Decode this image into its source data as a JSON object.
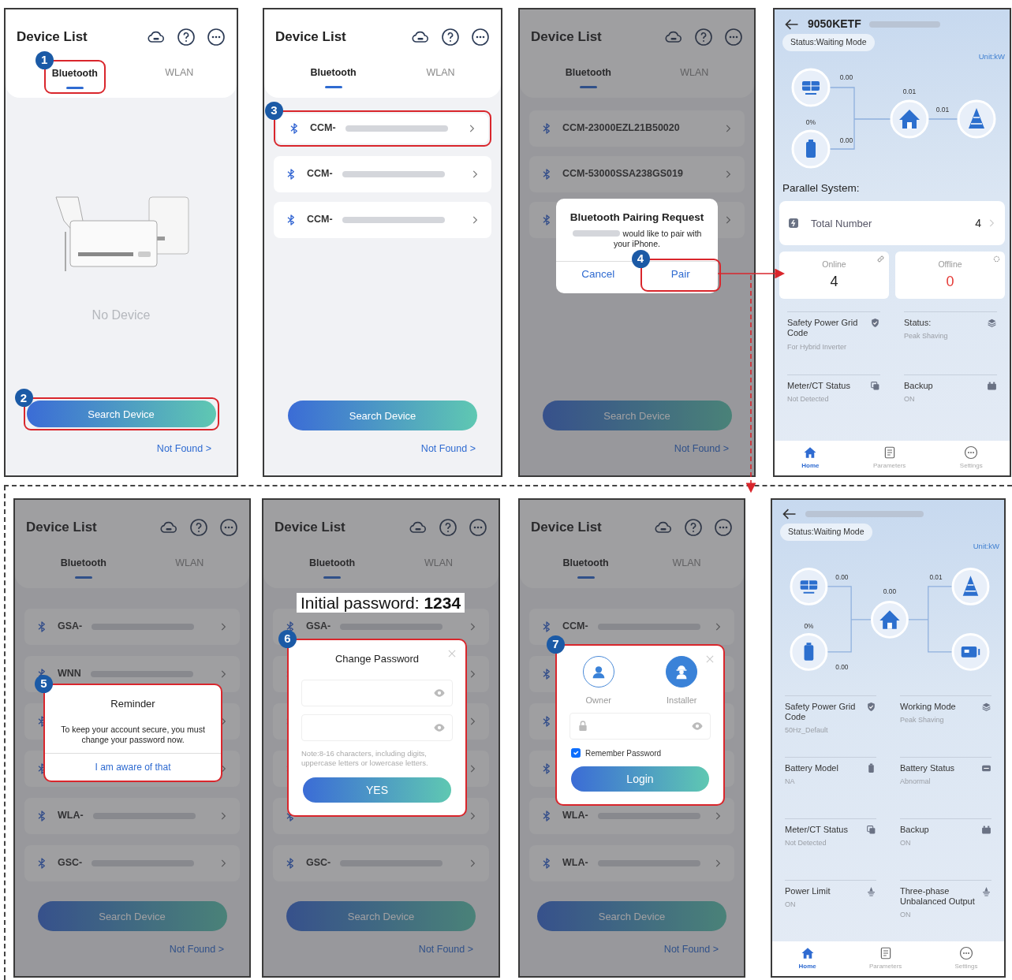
{
  "panels": [
    {
      "kind": "device_list",
      "title": "Device List",
      "dimmed": false,
      "tabs": [
        {
          "label": "Bluetooth",
          "selected": true,
          "step": "1"
        },
        {
          "label": "WLAN",
          "selected": false
        }
      ],
      "empty_text": "No Device",
      "search_button": {
        "label": "Search Device",
        "step": "2"
      },
      "not_found": "Not Found >"
    },
    {
      "kind": "device_list",
      "title": "Device List",
      "dimmed": false,
      "tabs": [
        {
          "label": "Bluetooth",
          "selected": true
        },
        {
          "label": "WLAN",
          "selected": false
        }
      ],
      "devices": [
        {
          "kind": "device",
          "name": "CCM-",
          "redacted": true,
          "step": "3"
        },
        {
          "kind": "device",
          "name": "CCM-",
          "redacted": true
        },
        {
          "kind": "device",
          "name": "CCM-",
          "redacted": true
        }
      ],
      "search_button": {
        "label": "Search Device"
      },
      "not_found": "Not Found >"
    },
    {
      "kind": "device_list",
      "title": "Device List",
      "dimmed": true,
      "tabs": [
        {
          "label": "Bluetooth",
          "selected": true
        },
        {
          "label": "WLAN",
          "selected": false
        }
      ],
      "devices": [
        {
          "kind": "device",
          "name": "CCM-23000EZL21B50020",
          "redacted": false
        },
        {
          "kind": "device",
          "name": "CCM-53000SSA238GS019",
          "redacted": false
        },
        {
          "kind": "covered"
        }
      ],
      "search_button": {
        "label": "Search Device"
      },
      "not_found": "Not Found >",
      "dialog": {
        "kind": "pairing",
        "title": "Bluetooth Pairing Request",
        "redacted": true,
        "message": "would like to pair with your iPhone.",
        "buttons": [
          {
            "label": "Cancel"
          },
          {
            "label": "Pair",
            "step": "4"
          }
        ]
      }
    },
    {
      "kind": "dashboard",
      "device_name": "9050KETF",
      "redacted": true,
      "status": "Status:Waiting Mode",
      "unit": "Unit:kW",
      "flow": [
        {
          "kind": "solar",
          "value": "0.00"
        },
        {
          "kind": "battery",
          "value": "0.00",
          "soc": "0%"
        },
        {
          "kind": "home",
          "value": "0.01"
        },
        {
          "kind": "grid",
          "value": "0.01"
        }
      ],
      "parallel": {
        "title": "Parallel System:",
        "total": {
          "label": "Total Number",
          "value": "4"
        },
        "online": {
          "label": "Online",
          "value": "4"
        },
        "offline": {
          "label": "Offline",
          "value": "0"
        }
      },
      "items": [
        {
          "label": "Safety Power Grid Code",
          "value": "For Hybrid Inverter",
          "kind": "grid_code"
        },
        {
          "label": "Status:",
          "value": "Peak Shaving",
          "kind": "mode"
        },
        {
          "label": "Meter/CT Status",
          "value": "Not Detected",
          "kind": "meter"
        },
        {
          "label": "Backup",
          "value": "ON",
          "kind": "backup"
        }
      ],
      "nav": [
        {
          "label": "Home",
          "kind": "home",
          "selected": true
        },
        {
          "label": "Parameters",
          "kind": "parameters",
          "selected": false
        },
        {
          "label": "Settings",
          "kind": "settings",
          "selected": false
        }
      ]
    },
    {
      "kind": "device_list",
      "title": "Device List",
      "dimmed": true,
      "tabs": [
        {
          "label": "Bluetooth",
          "selected": true
        },
        {
          "label": "WLAN",
          "selected": false
        }
      ],
      "devices": [
        {
          "kind": "device",
          "name": "GSA-",
          "redacted": true
        },
        {
          "kind": "device",
          "name": "WNN",
          "redacted": true
        },
        {
          "kind": "covered"
        },
        {
          "kind": "covered"
        },
        {
          "kind": "device",
          "name": "WLA-",
          "redacted": true
        },
        {
          "kind": "device",
          "name": "GSC-",
          "redacted": true
        }
      ],
      "search_button": {
        "label": "Search Device"
      },
      "not_found": "Not Found >",
      "dialog": {
        "kind": "reminder",
        "step": "5",
        "title": "Reminder",
        "message": "To keep your account secure, you must change your password  now.",
        "buttons": [
          {
            "label": "I am aware of that"
          }
        ]
      }
    },
    {
      "kind": "device_list",
      "title": "Device List",
      "dimmed": true,
      "tabs": [
        {
          "label": "Bluetooth",
          "selected": true
        },
        {
          "label": "WLAN",
          "selected": false
        }
      ],
      "caption": "Initial password: **1234**",
      "devices": [
        {
          "kind": "device",
          "name": "GSA-",
          "redacted": true
        },
        {
          "kind": "covered"
        },
        {
          "kind": "covered"
        },
        {
          "kind": "covered"
        },
        {
          "kind": "covered"
        },
        {
          "kind": "device",
          "name": "GSC-",
          "redacted": true
        }
      ],
      "search_button": {
        "label": "Search Device"
      },
      "not_found": "Not Found >",
      "dialog": {
        "kind": "change_password",
        "step": "6",
        "title": "Change Password",
        "closable": true,
        "fields": [
          {
            "kind": "password"
          },
          {
            "kind": "password"
          }
        ],
        "note": "Note:8-16 characters, including digits, uppercase letters or lowercase letters.",
        "buttons": [
          {
            "label": "YES"
          }
        ]
      }
    },
    {
      "kind": "device_list",
      "title": "Device List",
      "dimmed": true,
      "tabs": [
        {
          "label": "Bluetooth",
          "selected": true
        },
        {
          "label": "WLAN",
          "selected": false
        }
      ],
      "devices": [
        {
          "kind": "device",
          "name": "CCM-",
          "redacted": true
        },
        {
          "kind": "covered"
        },
        {
          "kind": "covered"
        },
        {
          "kind": "covered"
        },
        {
          "kind": "device",
          "name": "WLA-",
          "redacted": true
        },
        {
          "kind": "device",
          "name": "WLA-",
          "redacted": true
        }
      ],
      "search_button": {
        "label": "Search Device"
      },
      "not_found": "Not Found >",
      "dialog": {
        "kind": "login",
        "step": "7",
        "closable": true,
        "roles": [
          {
            "label": "Owner",
            "kind": "owner",
            "selected": false
          },
          {
            "label": "Installer",
            "kind": "installer",
            "selected": true
          }
        ],
        "fields": [
          {
            "kind": "locked_password"
          }
        ],
        "remember": {
          "label": "Remember Password",
          "checked": true
        },
        "buttons": [
          {
            "label": "Login"
          }
        ]
      }
    },
    {
      "kind": "dashboard",
      "redacted": true,
      "status": "Status:Waiting Mode",
      "unit": "Unit:kW",
      "flow": [
        {
          "kind": "solar",
          "value": "0.00"
        },
        {
          "kind": "battery",
          "value": "0.00",
          "soc": "0%"
        },
        {
          "kind": "home",
          "value": "0.00"
        },
        {
          "kind": "grid",
          "value": "0.01"
        },
        {
          "kind": "generator"
        }
      ],
      "items": [
        {
          "label": "Safety Power Grid Code",
          "value": "50Hz_Default",
          "kind": "grid_code"
        },
        {
          "label": "Working Mode",
          "value": "Peak Shaving",
          "kind": "mode"
        },
        {
          "label": "Battery Model",
          "value": "NA",
          "kind": "battery_model"
        },
        {
          "label": "Battery Status",
          "value": "Abnormal",
          "kind": "battery_status"
        },
        {
          "label": "Meter/CT Status",
          "value": "Not Detected",
          "kind": "meter"
        },
        {
          "label": "Backup",
          "value": "ON",
          "kind": "backup"
        },
        {
          "label": "Power Limit",
          "value": "ON",
          "kind": "limit"
        },
        {
          "label": "Three-phase Unbalanced Output",
          "value": "ON",
          "kind": "limit"
        }
      ],
      "nav": [
        {
          "label": "Home",
          "kind": "home",
          "selected": true
        },
        {
          "label": "Parameters",
          "kind": "parameters",
          "selected": false
        },
        {
          "label": "Settings",
          "kind": "settings",
          "selected": false
        }
      ]
    }
  ]
}
